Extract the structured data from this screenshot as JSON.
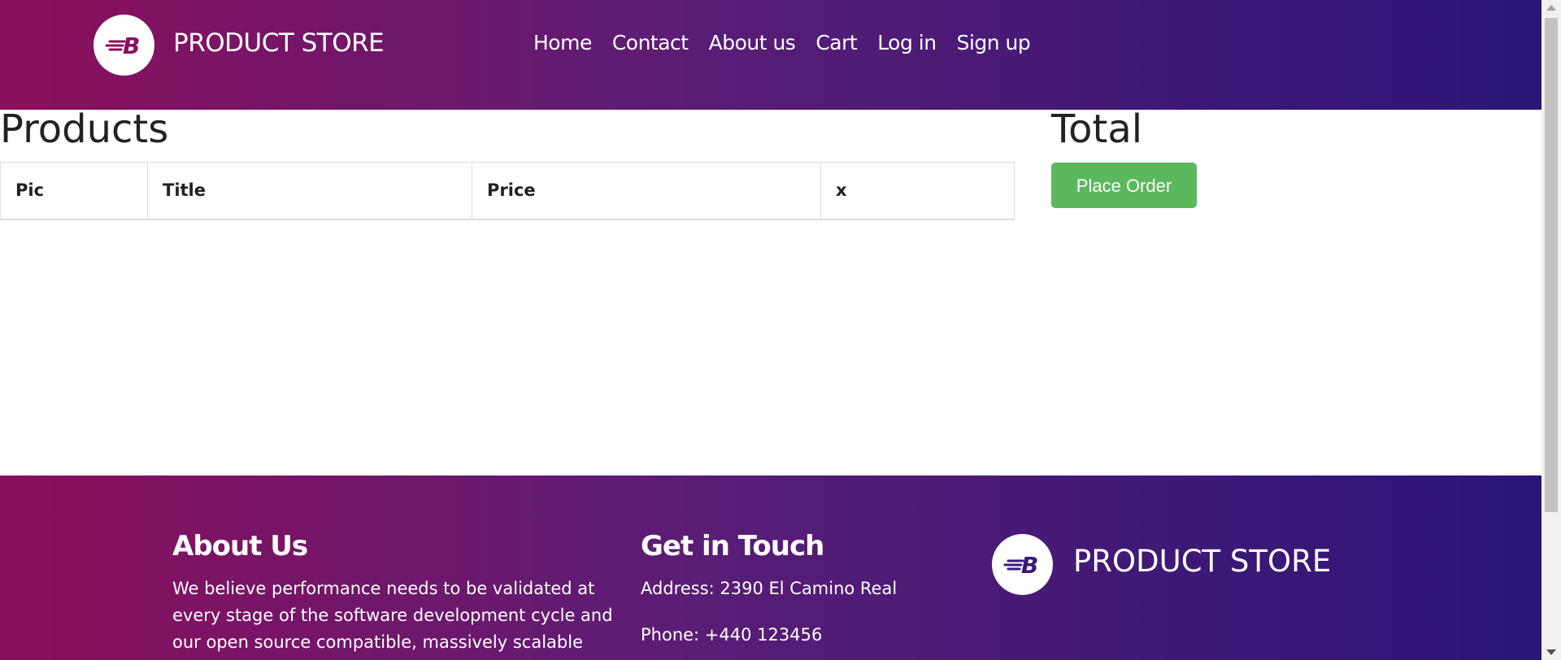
{
  "header": {
    "brand": "PRODUCT STORE",
    "logo_icon": "blazemeter-b-logo",
    "nav": [
      "Home",
      "Contact",
      "About us",
      "Cart",
      "Log in",
      "Sign up"
    ]
  },
  "main": {
    "products_heading": "Products",
    "table_headers": [
      "Pic",
      "Title",
      "Price",
      "x"
    ],
    "total_heading": "Total",
    "place_order_label": "Place Order"
  },
  "footer": {
    "about": {
      "heading": "About Us",
      "lines": [
        "We believe performance needs to be validated at",
        "every stage of the software development cycle and",
        "our open source compatible, massively scalable"
      ]
    },
    "contact": {
      "heading": "Get in Touch",
      "address": "Address: 2390 El Camino Real",
      "phone": "Phone: +440 123456"
    },
    "brand": "PRODUCT STORE"
  },
  "colors": {
    "gradient_start": "#8b0f5c",
    "gradient_end": "#2a1577",
    "button_green": "#5cb85c"
  }
}
